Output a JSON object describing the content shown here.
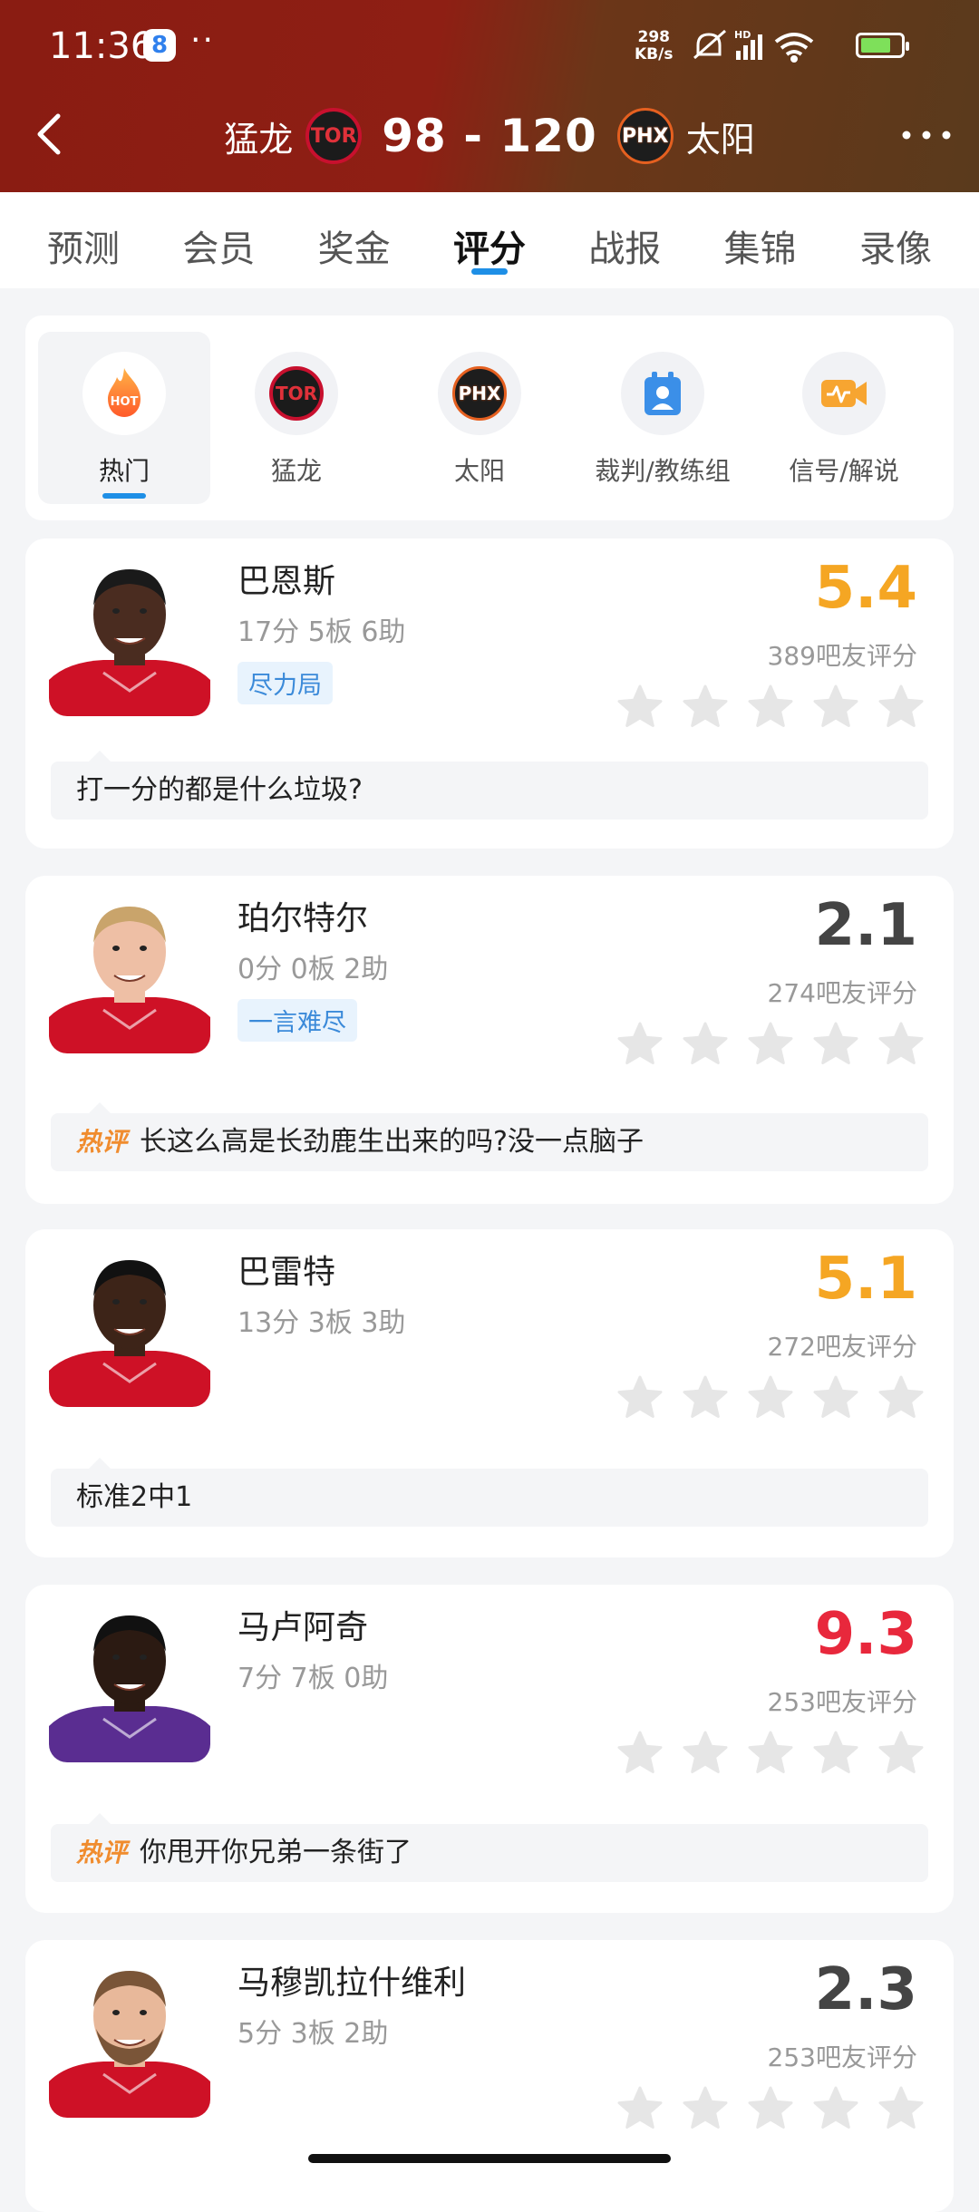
{
  "status_bar": {
    "time": "11:36",
    "app_badge": "8",
    "dots": "··",
    "net_speed_value": "298",
    "net_speed_unit": "KB/s",
    "battery_level": 0.75
  },
  "header": {
    "home_team": "猛龙",
    "home_logo": "TOR",
    "score": "98 - 120",
    "away_logo": "PHX",
    "away_team": "太阳"
  },
  "tabs": [
    {
      "label": "预测"
    },
    {
      "label": "会员"
    },
    {
      "label": "奖金"
    },
    {
      "label": "评分",
      "active": true
    },
    {
      "label": "战报"
    },
    {
      "label": "集锦"
    },
    {
      "label": "录像"
    }
  ],
  "categories": [
    {
      "label": "热门",
      "icon": "hot-icon",
      "icon_text": "HOT",
      "selected": true
    },
    {
      "label": "猛龙",
      "icon": "raptors-logo",
      "icon_text": "TOR"
    },
    {
      "label": "太阳",
      "icon": "suns-logo",
      "icon_text": "PHX"
    },
    {
      "label": "裁判/教练组",
      "icon": "referee-icon"
    },
    {
      "label": "信号/解说",
      "icon": "broadcast-icon"
    }
  ],
  "players": [
    {
      "name": "巴恩斯",
      "stats": "17分 5板 6助",
      "tag": "尽力局",
      "score": "5.4",
      "score_color": "#f5a623",
      "count": "389吧友评分",
      "comment": "打一分的都是什么垃圾?",
      "hot": false,
      "jersey": "#ce1126",
      "skin": "#4a2c20",
      "hair": "#1a1a1a",
      "beard": false
    },
    {
      "name": "珀尔特尔",
      "stats": "0分 0板 2助",
      "tag": "一言难尽",
      "score": "2.1",
      "score_color": "#444444",
      "count": "274吧友评分",
      "comment": "长这么高是长劲鹿生出来的吗?没一点脑子",
      "hot": true,
      "hot_label": "热评",
      "jersey": "#ce1126",
      "skin": "#eebfa5",
      "hair": "#c9a46b",
      "beard": false
    },
    {
      "name": "巴雷特",
      "stats": "13分 3板 3助",
      "tag": "",
      "score": "5.1",
      "score_color": "#f5a623",
      "count": "272吧友评分",
      "comment": "标准2中1",
      "hot": false,
      "jersey": "#ce1126",
      "skin": "#3d2418",
      "hair": "#111111",
      "beard": false
    },
    {
      "name": "马卢阿奇",
      "stats": "7分 7板 0助",
      "tag": "",
      "score": "9.3",
      "score_color": "#e8283c",
      "count": "253吧友评分",
      "comment": "你甩开你兄弟一条街了",
      "hot": true,
      "hot_label": "热评",
      "jersey": "#5a2d91",
      "skin": "#2b1a12",
      "hair": "#111111",
      "beard": false
    },
    {
      "name": "马穆凯拉什维利",
      "stats": "5分 3板 2助",
      "tag": "",
      "score": "2.3",
      "score_color": "#444444",
      "count": "253吧友评分",
      "comment": "",
      "hot": false,
      "jersey": "#ce1126",
      "skin": "#e8b89a",
      "hair": "#7a5538",
      "beard": true
    }
  ]
}
